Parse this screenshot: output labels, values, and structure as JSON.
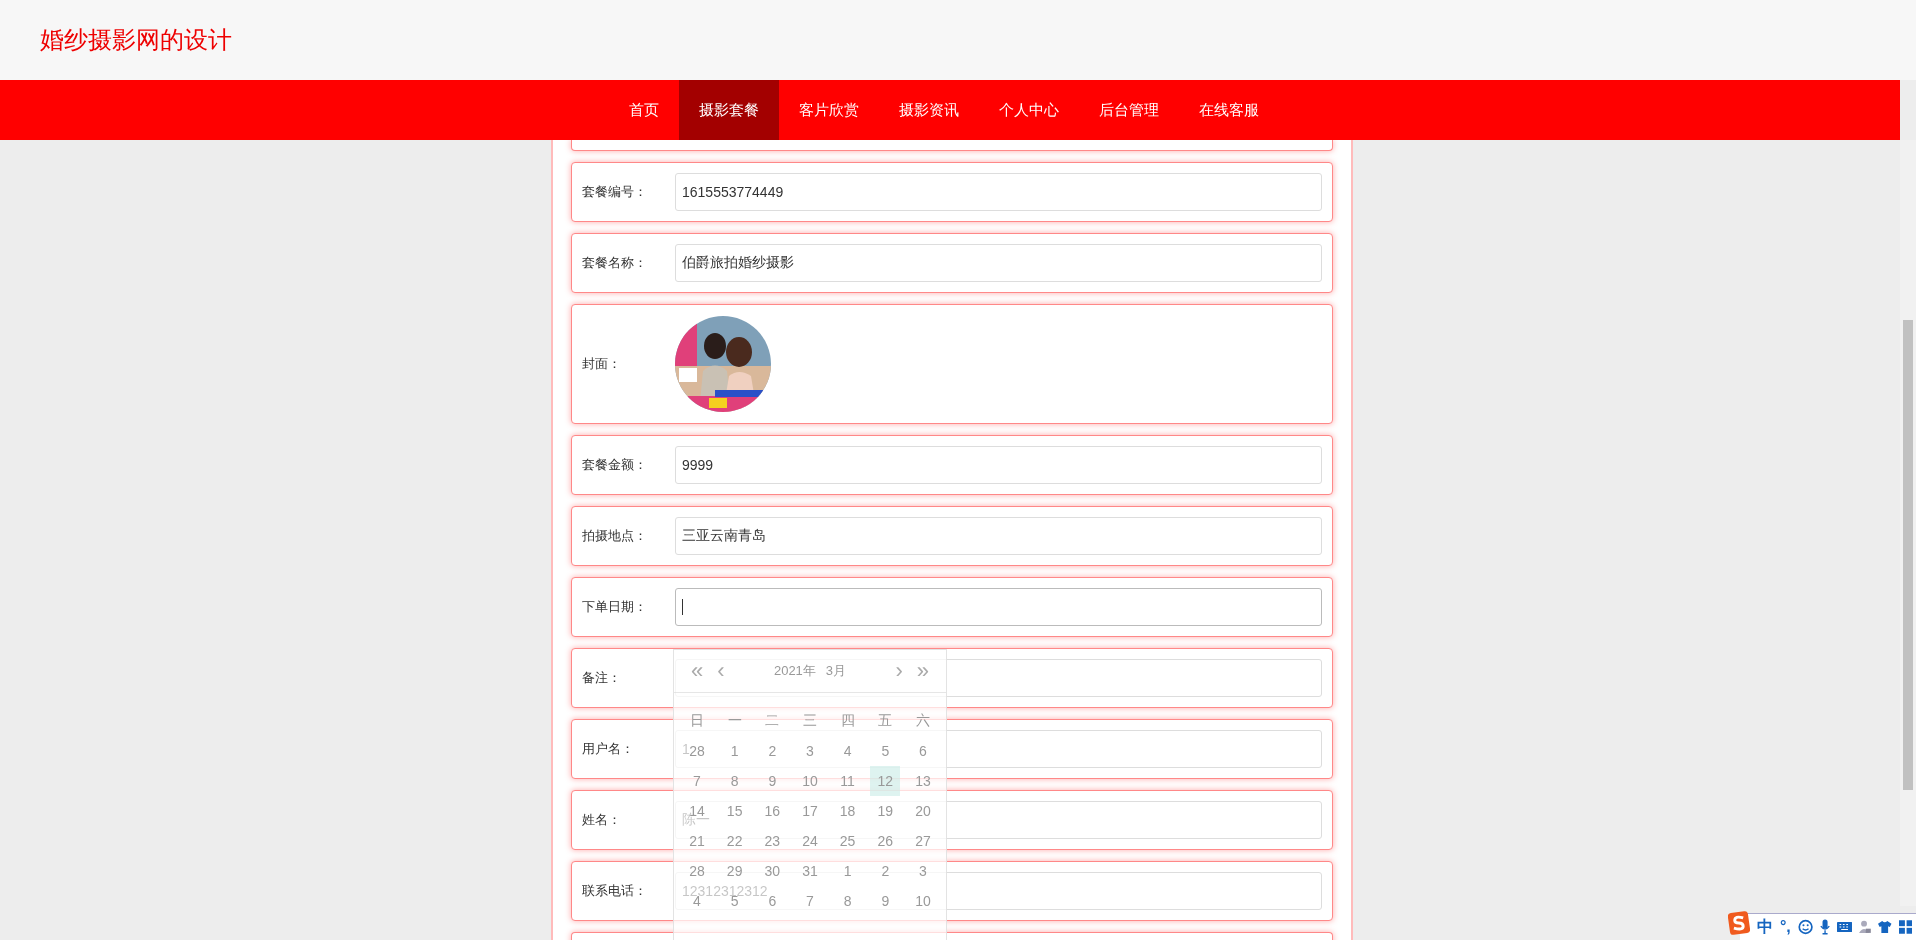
{
  "site": {
    "title": "婚纱摄影网的设计"
  },
  "nav": [
    {
      "label": "首页",
      "selected": false
    },
    {
      "label": "摄影套餐",
      "selected": true
    },
    {
      "label": "客片欣赏",
      "selected": false
    },
    {
      "label": "摄影资讯",
      "selected": false
    },
    {
      "label": "个人中心",
      "selected": false
    },
    {
      "label": "后台管理",
      "selected": false
    },
    {
      "label": "在线客服",
      "selected": false
    }
  ],
  "form": {
    "fields": [
      {
        "kind": "text",
        "label": "套餐编号：",
        "value": "1615553774449",
        "focused": false
      },
      {
        "kind": "text",
        "label": "套餐名称：",
        "value": "伯爵旅拍婚纱摄影",
        "focused": false
      },
      {
        "label": "封面："
      },
      {
        "kind": "text",
        "label": "套餐金额：",
        "value": "9999",
        "focused": false
      },
      {
        "kind": "text",
        "label": "拍摄地点：",
        "value": "三亚云南青岛",
        "focused": false
      },
      {
        "kind": "date",
        "label": "下单日期：",
        "focused": true
      },
      {
        "kind": "text",
        "label": "备注：",
        "focused": false
      },
      {
        "kind": "text",
        "label": "用户名：",
        "value": "1",
        "focused": false
      },
      {
        "kind": "text",
        "label": "姓名：",
        "value": "陈一",
        "focused": false
      },
      {
        "kind": "text",
        "label": "联系电话：",
        "value": "12312312312",
        "focused": false
      }
    ]
  },
  "date_picker": {
    "prev_year": "«",
    "prev_month": "‹",
    "year": "2021年",
    "month": "3月",
    "next_month": "›",
    "next_year": "»",
    "weekdays": [
      "日",
      "一",
      "二",
      "三",
      "四",
      "五",
      "六"
    ],
    "days": [
      {
        "label": "28",
        "selected": false
      },
      {
        "label": "1",
        "selected": false
      },
      {
        "label": "2",
        "selected": false
      },
      {
        "label": "3",
        "selected": false
      },
      {
        "label": "4",
        "selected": false
      },
      {
        "label": "5",
        "selected": false
      },
      {
        "label": "6",
        "selected": false
      },
      {
        "label": "7",
        "selected": false
      },
      {
        "label": "8",
        "selected": false
      },
      {
        "label": "9",
        "selected": false
      },
      {
        "label": "10",
        "selected": false
      },
      {
        "label": "11",
        "selected": false
      },
      {
        "label": "12",
        "selected": true
      },
      {
        "label": "13",
        "selected": false
      },
      {
        "label": "14",
        "selected": false
      },
      {
        "label": "15",
        "selected": false
      },
      {
        "label": "16",
        "selected": false
      },
      {
        "label": "17",
        "selected": false
      },
      {
        "label": "18",
        "selected": false
      },
      {
        "label": "19",
        "selected": false
      },
      {
        "label": "20",
        "selected": false
      },
      {
        "label": "21",
        "selected": false
      },
      {
        "label": "22",
        "selected": false
      },
      {
        "label": "23",
        "selected": false
      },
      {
        "label": "24",
        "selected": false
      },
      {
        "label": "25",
        "selected": false
      },
      {
        "label": "26",
        "selected": false
      },
      {
        "label": "27",
        "selected": false
      },
      {
        "label": "28",
        "selected": false
      },
      {
        "label": "29",
        "selected": false
      },
      {
        "label": "30",
        "selected": false
      },
      {
        "label": "31",
        "selected": false
      },
      {
        "label": "1",
        "selected": false
      },
      {
        "label": "2",
        "selected": false
      },
      {
        "label": "3",
        "selected": false
      },
      {
        "label": "4",
        "selected": false
      },
      {
        "label": "5",
        "selected": false
      },
      {
        "label": "6",
        "selected": false
      },
      {
        "label": "7",
        "selected": false
      },
      {
        "label": "8",
        "selected": false
      },
      {
        "label": "9",
        "selected": false
      },
      {
        "label": "10",
        "selected": false
      }
    ]
  },
  "ime": {
    "mode": "中",
    "punctuation": "°,"
  }
}
